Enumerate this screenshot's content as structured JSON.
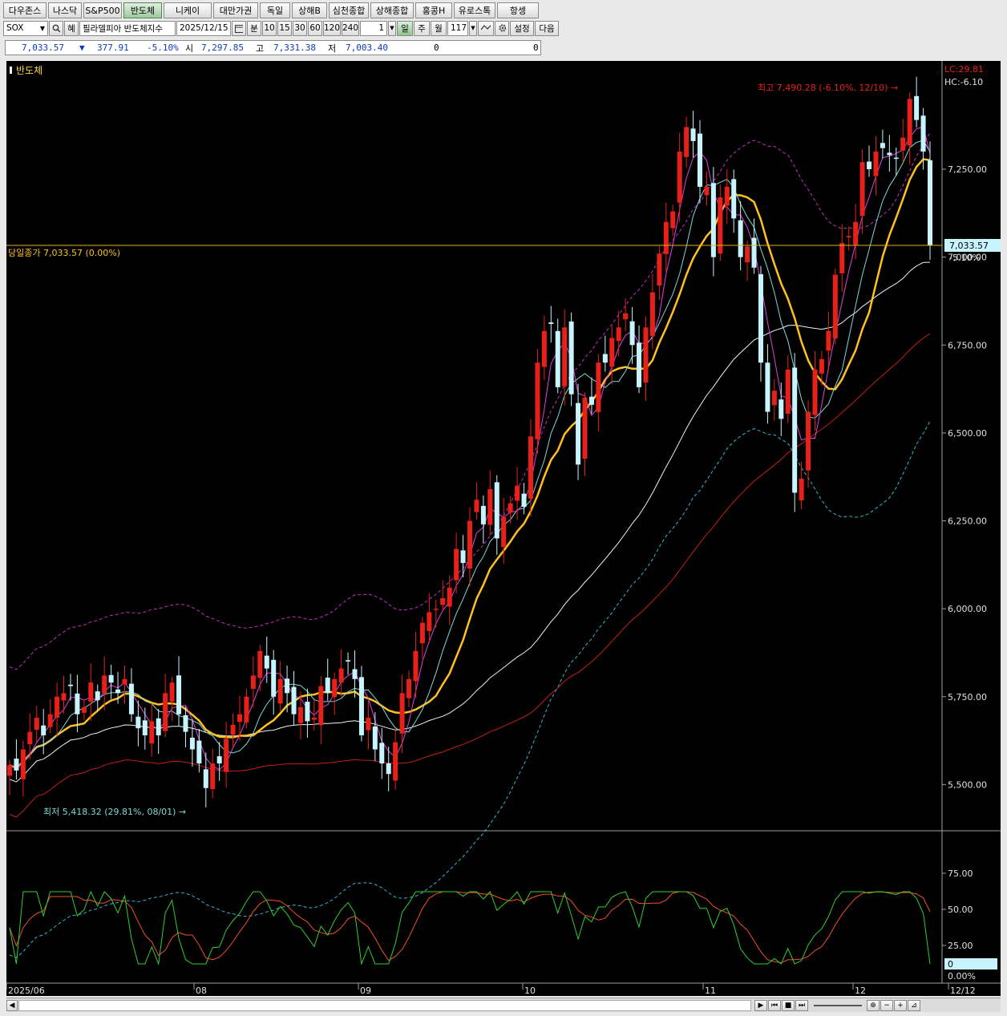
{
  "tabs": [
    {
      "label": "다우존스",
      "w": 54
    },
    {
      "label": "나스닥",
      "w": 42
    },
    {
      "label": "S&P500",
      "w": 48
    },
    {
      "label": "반도체",
      "w": 48,
      "active": true
    },
    {
      "label": "니케이",
      "w": 60
    },
    {
      "label": "대만가권",
      "w": 56
    },
    {
      "label": "독일",
      "w": 38
    },
    {
      "label": "상해B",
      "w": 44
    },
    {
      "label": "심천종합",
      "w": 50
    },
    {
      "label": "상해종합",
      "w": 54
    },
    {
      "label": "홍콩H",
      "w": 46
    },
    {
      "label": "유로스톡",
      "w": 52
    },
    {
      "label": "항셍",
      "w": 52
    }
  ],
  "toolbar": {
    "symbol": "SOX",
    "search_icon": "magnifier-icon",
    "type_label": "혜",
    "name": "필라델피아 반도체지수",
    "date": "2025/12/15",
    "calendar_icon": "calendar-icon",
    "unit_label": "분",
    "periods": [
      "10",
      "15",
      "30",
      "60",
      "120",
      "240"
    ],
    "count_value": "1",
    "day_label": "일",
    "week_label": "주",
    "month_label": "월",
    "bars_value": "117",
    "settings_label": "설정",
    "next_label": "다음"
  },
  "quote": {
    "price": "7,033.57",
    "arrow": "▼",
    "change": "377.91",
    "change_pct": "-5.10%",
    "open_label": "시",
    "open": "7,297.85",
    "high_label": "고",
    "high": "7,331.38",
    "low_label": "저",
    "low": "7,003.40",
    "vol1": "0",
    "vol2": "0"
  },
  "chart": {
    "title": "반도체",
    "lc_label": "LC:29.81",
    "hc_label": "HC:-6.10",
    "high_annotation": "최고 7,490.28 (-6.10%, 12/10) →",
    "low_annotation": "최저 5,418.32 (29.81%, 08/01) →",
    "close_line_label": "당일종가 7,033.57 (0.00%)",
    "last_price_tag": "7,033.57",
    "last_change_tag": "-5.10%",
    "price_ticks": [
      "7,250.00",
      "7,000.00",
      "6,750.00",
      "6,500.00",
      "6,250.00",
      "6,000.00",
      "5,750.00",
      "5,500.00"
    ],
    "date_ticks": [
      "2025/06",
      "08",
      "09",
      "10",
      "11",
      "12",
      "12/12"
    ],
    "osc_ticks": [
      "75.00",
      "50.00",
      "25.00",
      "0",
      "0.00%"
    ],
    "colors": {
      "up": "#e8201a",
      "down": "#c8f4ff",
      "ma_fast": "#e040e0",
      "ma_mid": "#7fd8d8",
      "ma_main": "#ffc021",
      "ma_slow": "#f2f2f2",
      "ma_long": "#c0201a",
      "band": "#c030c0",
      "band_lower": "#30b8d0"
    }
  },
  "chart_data": {
    "type": "candlestick",
    "ylim": [
      5418.32,
      7490.28
    ],
    "last_close": 7033.57,
    "max": {
      "value": 7490.28,
      "date": "12/10"
    },
    "min": {
      "value": 5418.32,
      "date": "08/01"
    }
  },
  "scrollbar": {
    "buttons": [
      "▶",
      "⏮",
      "■",
      "⏭",
      "−",
      "+"
    ]
  }
}
